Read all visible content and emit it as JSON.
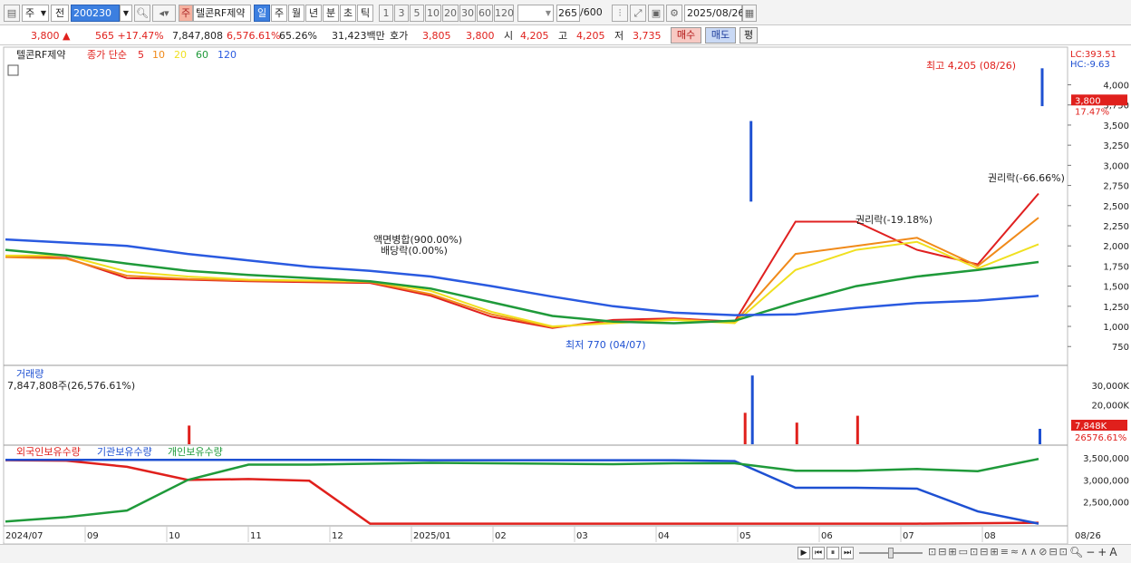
{
  "toolbar": {
    "code_type": "주",
    "period_btn": "전",
    "code": "200230",
    "stock_tag": "주",
    "stock_name": "텔콘RF제약",
    "periods": [
      "일",
      "주",
      "월",
      "년",
      "분",
      "초",
      "틱"
    ],
    "active_period": "일",
    "intervals": [
      "1",
      "3",
      "5",
      "10",
      "20",
      "30",
      "60",
      "120"
    ],
    "count": "265",
    "count_max": "/600",
    "date": "2025/08/26"
  },
  "quote": {
    "price": "3,800 ▲",
    "change": "565 +17.47%",
    "volume": "7,847,808",
    "volume_ratio": "6,576.61%",
    "turnover": "65.26%",
    "amount": "31,423백만",
    "ask_label": "호가",
    "ask": "3,805",
    "bid": "3,800",
    "open_label": "시",
    "open": "4,205",
    "high_label": "고",
    "high": "4,205",
    "low_label": "저",
    "low": "3,735",
    "buy_label": "매수",
    "sell_label": "매도",
    "avg_label": "평"
  },
  "colors": {
    "up": "#e0201c",
    "down": "#1e50d2",
    "ma5": "#e02020",
    "ma10": "#f08a1a",
    "ma20": "#f0e020",
    "ma60": "#1f9a3a",
    "ma120": "#2a5ae0"
  },
  "chart_data": [
    {
      "type": "line",
      "name": "price",
      "legend": {
        "name": "텔콘RF제약",
        "label": "종가 단순",
        "ma": [
          "5",
          "10",
          "20",
          "60",
          "120"
        ]
      },
      "ylim": [
        550,
        4400
      ],
      "yticks": [
        750,
        1000,
        1250,
        1500,
        1750,
        2000,
        2250,
        2500,
        2750,
        3000,
        3250,
        3500,
        3750,
        4000
      ],
      "ytick_labels": [
        "750",
        "1,000",
        "1,250",
        "1,500",
        "1,750",
        "2,000",
        "2,250",
        "2,500",
        "2,750",
        "3,000",
        "3,250",
        "3,500",
        "3,750",
        "4,000"
      ],
      "axis_top_labels": [
        "LC:393.51",
        "HC:-9.63"
      ],
      "last_price_label": "3,800",
      "last_pct_label": "17.47%",
      "annotations": [
        "최고 4,205 (08/26)",
        "최저 770 (04/07)",
        "액면병합(900.00%)",
        "배당락(0.00%)",
        "권리락(-19.18%)",
        "권리락(-66.66%)"
      ],
      "x": [
        "2024/07",
        "2024/08",
        "2024/09",
        "2024/10",
        "2024/11",
        "2024/12",
        "2025/01",
        "2025/02",
        "2025/03",
        "2025/04",
        "2025/05",
        "2025/06",
        "2025/06b",
        "2025/07",
        "2025/07b",
        "2025/08",
        "2025/08b",
        "2025/08/26"
      ],
      "series": [
        {
          "name": "5",
          "values": [
            1870,
            1850,
            1600,
            1580,
            1560,
            1550,
            1540,
            1380,
            1120,
            980,
            1080,
            1100,
            1060,
            2300,
            2300,
            1950,
            1770,
            2650
          ]
        },
        {
          "name": "10",
          "values": [
            1860,
            1840,
            1630,
            1590,
            1570,
            1560,
            1550,
            1400,
            1150,
            990,
            1050,
            1090,
            1050,
            1900,
            2000,
            2100,
            1750,
            2350
          ]
        },
        {
          "name": "20",
          "values": [
            1880,
            1880,
            1680,
            1620,
            1580,
            1570,
            1560,
            1440,
            1180,
            1000,
            1040,
            1080,
            1040,
            1700,
            1950,
            2050,
            1720,
            2020
          ]
        },
        {
          "name": "60",
          "values": [
            1950,
            1880,
            1780,
            1690,
            1640,
            1600,
            1560,
            1470,
            1300,
            1130,
            1060,
            1040,
            1070,
            1300,
            1500,
            1620,
            1700,
            1800
          ]
        },
        {
          "name": "120",
          "values": [
            2080,
            2040,
            2000,
            1900,
            1820,
            1740,
            1690,
            1620,
            1500,
            1370,
            1250,
            1170,
            1140,
            1150,
            1230,
            1290,
            1320,
            1380
          ]
        }
      ]
    },
    {
      "type": "bar",
      "name": "volume",
      "title": "거래량",
      "subtitle": "7,847,808주(26,576.61%)",
      "ylim": [
        0,
        36000
      ],
      "ytick_labels": [
        "20,000K",
        "30,000K"
      ],
      "yticks": [
        20000,
        30000
      ],
      "last_label": "7,848K",
      "last_pct": "26576.61%",
      "spikes_x": [
        "2024/10",
        "2025/06b",
        "2025/06b",
        "2025/07",
        "2025/07b",
        "2025/08/26"
      ],
      "spikes_values": [
        9500,
        16000,
        35000,
        11000,
        14500,
        7848
      ]
    },
    {
      "type": "line",
      "name": "holdings",
      "legend": [
        "외국인보유수량",
        "기관보유수량",
        "개인보유수량"
      ],
      "ylim": [
        1950000,
        3650000
      ],
      "yticks": [
        2500000,
        3000000,
        3500000
      ],
      "ytick_labels": [
        "2,500,000",
        "3,000,000",
        "3,500,000"
      ],
      "x": [
        "2024/07",
        "2024/08",
        "2024/09",
        "2024/10",
        "2024/11",
        "2024/12",
        "2025/01",
        "2025/02",
        "2025/03",
        "2025/04",
        "2025/05",
        "2025/06",
        "2025/06b",
        "2025/07",
        "2025/07b",
        "2025/08",
        "2025/08b",
        "2025/08/26"
      ],
      "series": [
        {
          "name": "외국인보유수량",
          "values": [
            3450000,
            3440000,
            3300000,
            3000000,
            3020000,
            2980000,
            2000000,
            2000000,
            2000000,
            2000000,
            2000000,
            2000000,
            2000000,
            2000000,
            2000000,
            2000000,
            2010000,
            2020000
          ]
        },
        {
          "name": "기관보유수량",
          "values": [
            3460000,
            3460000,
            3460000,
            3460000,
            3460000,
            3460000,
            3460000,
            3450000,
            3450000,
            3450000,
            3450000,
            3450000,
            3430000,
            2820000,
            2820000,
            2800000,
            2280000,
            2000000
          ]
        },
        {
          "name": "개인보유수량",
          "values": [
            2050000,
            2150000,
            2300000,
            3000000,
            3350000,
            3350000,
            3370000,
            3390000,
            3380000,
            3370000,
            3360000,
            3380000,
            3380000,
            3210000,
            3210000,
            3250000,
            3200000,
            3480000
          ]
        }
      ]
    }
  ],
  "xaxis": {
    "labels": [
      "2024/07",
      "09",
      "10",
      "11",
      "12",
      "2025/01",
      "02",
      "03",
      "04",
      "05",
      "06",
      "07",
      "08",
      "08/26"
    ]
  }
}
